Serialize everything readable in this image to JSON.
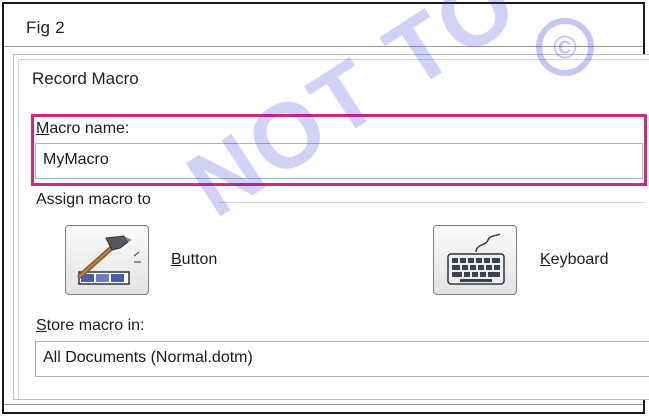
{
  "figure": {
    "caption": "Fig 2"
  },
  "dialog": {
    "title": "Record Macro",
    "macro_name": {
      "access_key": "M",
      "label_rest": "acro name:",
      "value": "MyMacro"
    },
    "assign_group": {
      "label": "Assign macro to"
    },
    "button_option": {
      "access_key": "B",
      "label_rest": "utton",
      "icon": "hammer-toolbar-icon"
    },
    "keyboard_option": {
      "access_key": "K",
      "label_rest": "eyboard",
      "icon": "keyboard-icon"
    },
    "store_in": {
      "access_key": "S",
      "label_rest": "tore macro in:",
      "value": "All Documents (Normal.dotm)"
    },
    "highlight_color": "#d4267e"
  },
  "watermark": {
    "text": "NOT TO BE",
    "symbol": "©",
    "color": "#2e34e0"
  }
}
